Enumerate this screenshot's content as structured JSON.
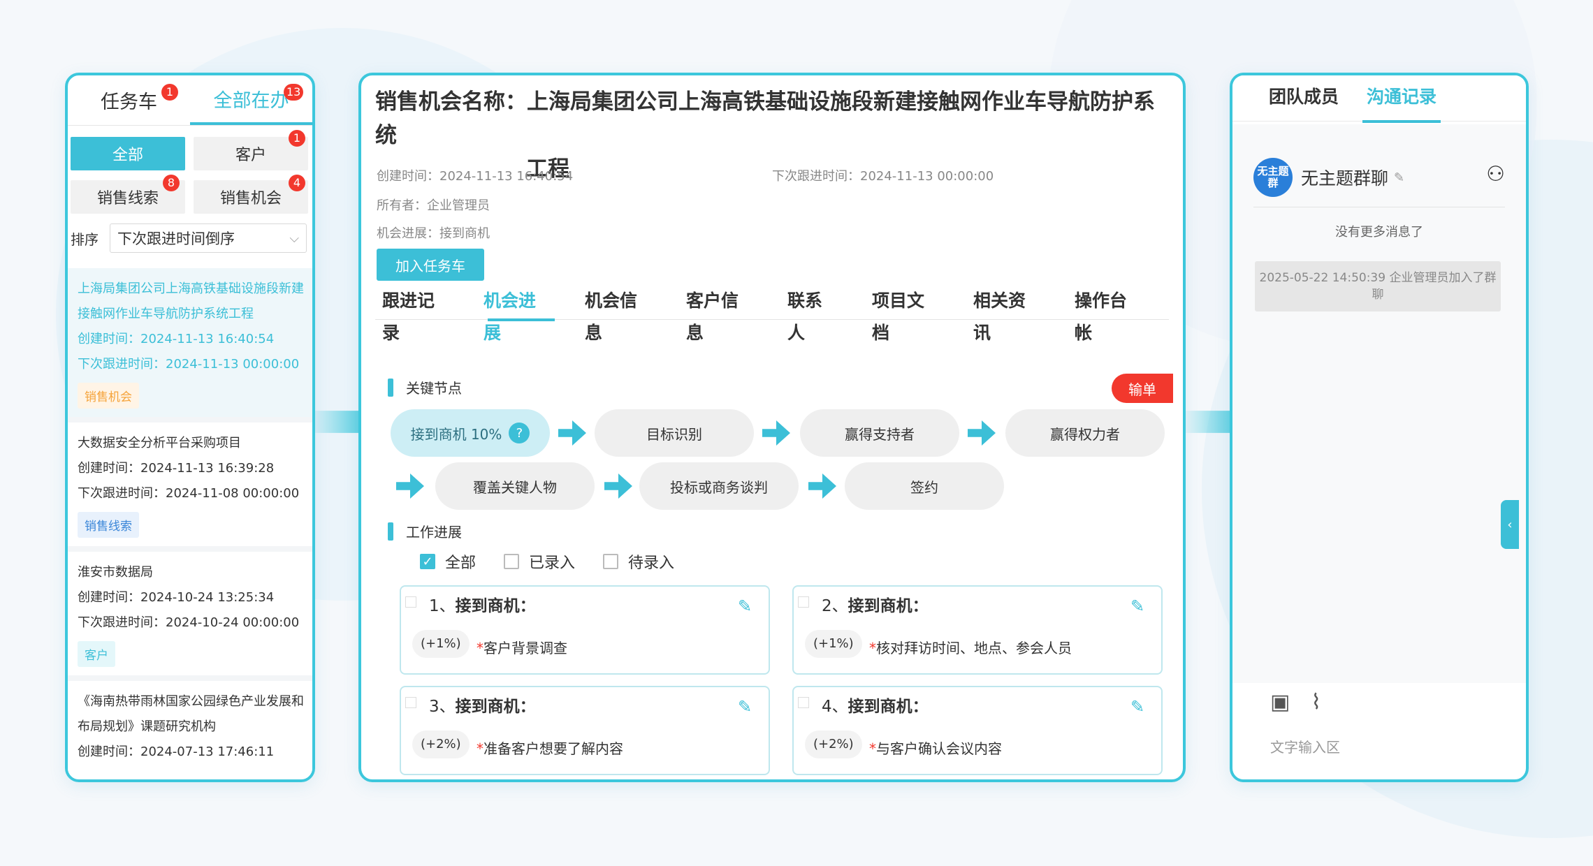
{
  "left_panel": {
    "tabs": [
      {
        "label": "任务车",
        "badge": "1"
      },
      {
        "label": "全部在办",
        "badge": "13"
      }
    ],
    "filters": [
      {
        "label": "全部",
        "badge": ""
      },
      {
        "label": "客户",
        "badge": "1"
      },
      {
        "label": "销售线索",
        "badge": "8"
      },
      {
        "label": "销售机会",
        "badge": "4"
      }
    ],
    "sort_label": "排序",
    "sort_value": "下次跟进时间倒序",
    "items": [
      {
        "title": "上海局集团公司上海高铁基础设施段新建接触网作业车导航防护系统工程",
        "created": "创建时间：2024-11-13 16:40:54",
        "next": "下次跟进时间：2024-11-13 00:00:00",
        "tag": "销售机会"
      },
      {
        "title": "大数据安全分析平台采购项目",
        "created": "创建时间：2024-11-13 16:39:28",
        "next": "下次跟进时间：2024-11-08 00:00:00",
        "tag": "销售线索"
      },
      {
        "title": "淮安市数据局",
        "created": "创建时间：2024-10-24 13:25:34",
        "next": "下次跟进时间：2024-10-24 00:00:00",
        "tag": "客户"
      },
      {
        "title": "《海南热带雨林国家公园绿色产业发展和布局规划》课题研究机构",
        "created": "创建时间：2024-07-13 17:46:11",
        "next": "",
        "tag": ""
      }
    ]
  },
  "main_panel": {
    "title_line1": "销售机会名称：上海局集团公司上海高铁基础设施段新建接触网作业车导航防护系统",
    "title_line2": "工程",
    "created": "创建时间：2024-11-13 16:40:54",
    "next_follow": "下次跟进时间：2024-11-13 00:00:00",
    "owner": "所有者：企业管理员",
    "progress": "机会进展：接到商机",
    "add_button": "加入任务车",
    "tabs": [
      "跟进记录",
      "机会进展",
      "机会信息",
      "客户信息",
      "联系人",
      "项目文档",
      "相关资讯",
      "操作台帐"
    ],
    "key_nodes_label": "关键节点",
    "lose_button": "输单",
    "nodes": [
      "接到商机 10%",
      "目标识别",
      "赢得支持者",
      "赢得权力者",
      "覆盖关键人物",
      "投标或商务谈判",
      "签约"
    ],
    "work_label": "工作进展",
    "check_options": [
      "全部",
      "已录入",
      "待录入"
    ],
    "cards": [
      {
        "num": "1、",
        "title": "接到商机：",
        "pct": "(+1%)",
        "desc": "客户背景调查"
      },
      {
        "num": "2、",
        "title": "接到商机：",
        "pct": "(+1%)",
        "desc": "核对拜访时间、地点、参会人员"
      },
      {
        "num": "3、",
        "title": "接到商机：",
        "pct": "(+2%)",
        "desc": "准备客户想要了解内容"
      },
      {
        "num": "4、",
        "title": "接到商机：",
        "pct": "(+2%)",
        "desc": "与客户确认会议内容"
      }
    ]
  },
  "right_panel": {
    "tabs": [
      "团队成员",
      "沟通记录"
    ],
    "avatar_text": "无主题群",
    "group_name": "无主题群聊",
    "no_more": "没有更多消息了",
    "system_msg": "2025-05-22 14:50:39 企业管理员加入了群聊",
    "input_placeholder": "文字输入区"
  },
  "colors": {
    "accent": "#3cbfd7",
    "badge": "#f2382d"
  },
  "icons": [
    "edit-icon",
    "image-icon",
    "attachment-icon",
    "add-member-icon",
    "pencil-icon",
    "chevron-down-icon",
    "chevron-left-icon"
  ]
}
